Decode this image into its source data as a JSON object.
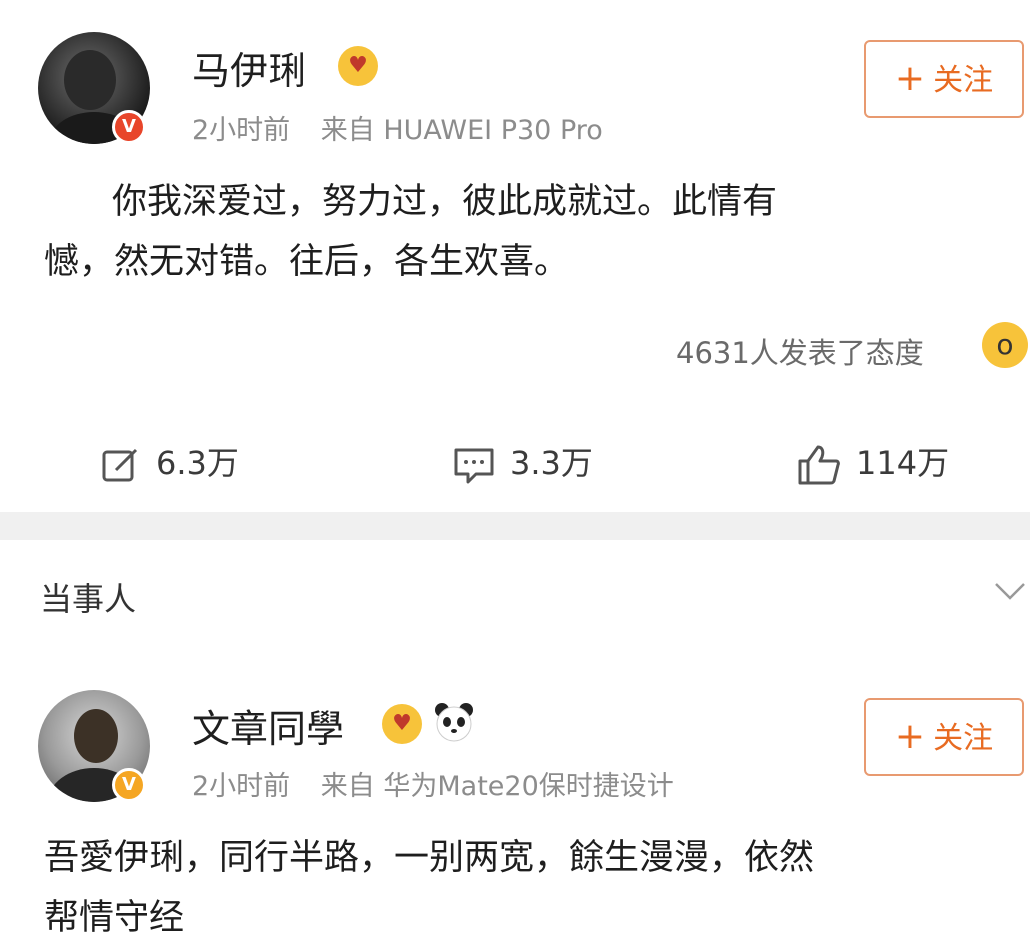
{
  "post1": {
    "username": "马伊琍",
    "time": "2小时前",
    "source": "来自 HUAWEI P30 Pro",
    "follow_label": "关注",
    "content_line1": "你我深爱过，努力过，彼此成就过。此情有",
    "content_line2": "憾，然无对错。往后，各生欢喜。",
    "reactions_text": "4631人发表了态度",
    "repost_count": "6.3万",
    "comment_count": "3.3万",
    "like_count": "114万"
  },
  "section": {
    "title": "当事人"
  },
  "post2": {
    "username": "文章同學",
    "time": "2小时前",
    "source": "来自 华为Mate20保时捷设计",
    "follow_label": "关注",
    "content_line1": "吾愛伊琍，同行半路，一别两宽，餘生漫漫，依然",
    "content_line2": "帮情守经"
  },
  "colors": {
    "accent": "#e86b22",
    "verified_gold": "#f5a623",
    "verified_red": "#e8452a",
    "meta_gray": "#8c8c8c"
  },
  "icons": [
    "repost-icon",
    "comment-icon",
    "like-icon",
    "chevron-down-icon",
    "heart-eyes-icon",
    "panda-icon",
    "surprised-face-icon"
  ]
}
